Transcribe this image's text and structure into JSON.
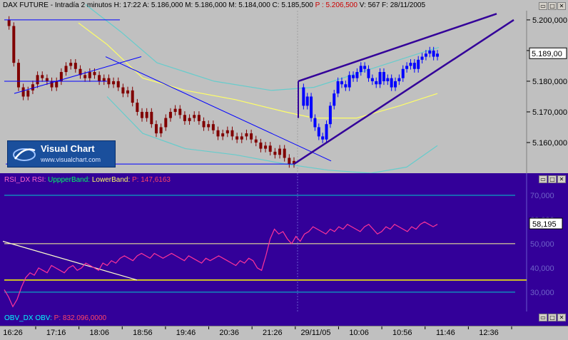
{
  "header_price": {
    "instrument": "DAX FUTURE",
    "period": "Intradía 2 minutos",
    "h_label": "H:",
    "h_value": "17:22",
    "a_label": "A:",
    "a_value": "5.186,000",
    "m_label": "M:",
    "m_value": "5.186,000",
    "m2_label": "M:",
    "m2_value": "5.184,000",
    "c_label": "C:",
    "c_value": "5.185,500",
    "p_label": "P :",
    "p_value": "5.206,500",
    "v_label": "V:",
    "v_value": "567",
    "f_label": "F:",
    "f_value": "28/11/2005"
  },
  "header_rsi": {
    "name": "RSI_DX",
    "rsi_label": "RSI:",
    "rsi_value": "",
    "upper_label": "UppperBand:",
    "upper_value": "",
    "lower_label": "LowerBand:",
    "lower_value": "",
    "p_label": "P:",
    "p_value": "147,6163"
  },
  "header_obv": {
    "name": "OBV_DX",
    "obv_label": "OBV:",
    "obv_value": "",
    "p_label": "P:",
    "p_value": "832.096,0000"
  },
  "logo": {
    "title": "Visual Chart",
    "url": "www.visualchart.com"
  },
  "window_buttons": [
    "restore",
    "maximize",
    "close"
  ],
  "colors": {
    "price_bg": "#c0c0c0",
    "indicator_bg": "#330099",
    "candles": "#800000",
    "after_close": "#0000ff",
    "trendline_blue": "#0000ff",
    "channel": "#330099",
    "ma_slow": "#66cccc",
    "ma_yellow": "#ffff66",
    "rsi_line": "#ff3399",
    "band_cyan": "#00cccc",
    "band_yellow": "#ffff99",
    "highlight": "#ffff00"
  },
  "chart_data": [
    {
      "type": "line",
      "name": "price",
      "y_ticks": [
        "5.200,000",
        "5.190,000",
        "5.180,000",
        "5.170,000",
        "5.160,000"
      ],
      "ylim": [
        5150,
        5203
      ],
      "last_value_label": "5.189,00",
      "last_value": 5189.0,
      "session1_close": [
        5200,
        5198,
        5186,
        5178,
        5175,
        5177,
        5179,
        5182,
        5181,
        5180,
        5178,
        5180,
        5183,
        5185,
        5186,
        5184,
        5182,
        5181,
        5183,
        5182,
        5180,
        5181,
        5179,
        5180,
        5178,
        5176,
        5177,
        5173,
        5170,
        5168,
        5170,
        5166,
        5163,
        5165,
        5168,
        5170,
        5171,
        5169,
        5167,
        5168,
        5169,
        5167,
        5165,
        5166,
        5164,
        5162,
        5163,
        5164,
        5162,
        5161,
        5162,
        5163,
        5161,
        5160,
        5158,
        5159,
        5157,
        5156,
        5158,
        5155,
        5153,
        5154
      ],
      "session2_close": [
        5178,
        5172,
        5175,
        5168,
        5165,
        5162,
        5161,
        5166,
        5172,
        5176,
        5180,
        5179,
        5178,
        5182,
        5181,
        5183,
        5185,
        5184,
        5181,
        5180,
        5179,
        5183,
        5180,
        5181,
        5178,
        5180,
        5181,
        5184,
        5185,
        5186,
        5184,
        5187,
        5188,
        5189,
        5190,
        5188,
        5189
      ]
    },
    {
      "type": "line",
      "name": "RSI_DX",
      "y_ticks": [
        "70,000",
        "60,000",
        "50,000",
        "40,000",
        "30,000"
      ],
      "ylim": [
        22,
        75
      ],
      "last_value_label": "58,195",
      "last_value": 58.195,
      "left_label": "",
      "values": [
        31,
        28,
        24,
        27,
        32,
        36,
        38,
        37,
        40,
        39,
        38,
        41,
        40,
        39,
        38,
        40,
        41,
        39,
        40,
        42,
        41,
        40,
        39,
        42,
        41,
        43,
        42,
        44,
        45,
        44,
        43,
        45,
        46,
        45,
        44,
        46,
        45,
        44,
        45,
        46,
        45,
        44,
        43,
        45,
        44,
        43,
        42,
        44,
        43,
        44,
        45,
        44,
        43,
        42,
        41,
        43,
        42,
        44,
        43,
        40,
        39,
        45,
        52,
        56,
        54,
        55,
        52,
        50,
        53,
        51,
        54,
        55,
        57,
        56,
        55,
        54,
        56,
        55,
        57,
        56,
        58,
        57,
        56,
        55,
        57,
        58,
        56,
        54,
        55,
        57,
        56,
        58,
        57,
        56,
        55,
        57,
        56,
        58,
        59,
        58,
        57,
        58
      ]
    }
  ],
  "time_labels": [
    "16:26",
    "17:16",
    "18:06",
    "18:56",
    "19:46",
    "20:36",
    "21:26",
    "29/11/05",
    "10:06",
    "10:56",
    "11:46",
    "12:36"
  ]
}
